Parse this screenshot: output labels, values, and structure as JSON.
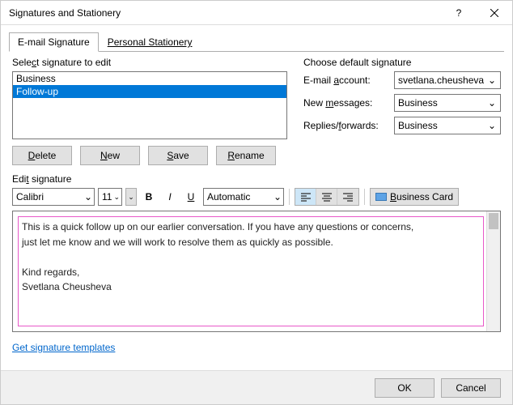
{
  "window": {
    "title": "Signatures and Stationery"
  },
  "tabs": {
    "email": "E-mail Signature",
    "stationery": "Personal Stationery"
  },
  "select_label": "Select signature to edit",
  "signatures": {
    "items": [
      "Business",
      "Follow-up"
    ],
    "selected_index": 1
  },
  "buttons": {
    "delete": "Delete",
    "new": "New",
    "save": "Save",
    "rename": "Rename"
  },
  "defaults": {
    "group_label": "Choose default signature",
    "account_label": "E-mail account:",
    "account_value": "svetlana.cheusheva",
    "newmsg_label": "New messages:",
    "newmsg_value": "Business",
    "replies_label": "Replies/forwards:",
    "replies_value": "Business"
  },
  "edit_label": "Edit signature",
  "toolbar": {
    "font": "Calibri",
    "size": "11",
    "color": "Automatic",
    "bizcard": "Business Card"
  },
  "editor": {
    "line1": "This is a quick follow up on our earlier conversation. If you have any questions or concerns,",
    "line2": "just let me know and we will work to resolve them as quickly as possible.",
    "line3": "Kind regards,",
    "line4": "Svetlana Cheusheva"
  },
  "link": "Get signature templates",
  "footer": {
    "ok": "OK",
    "cancel": "Cancel"
  }
}
